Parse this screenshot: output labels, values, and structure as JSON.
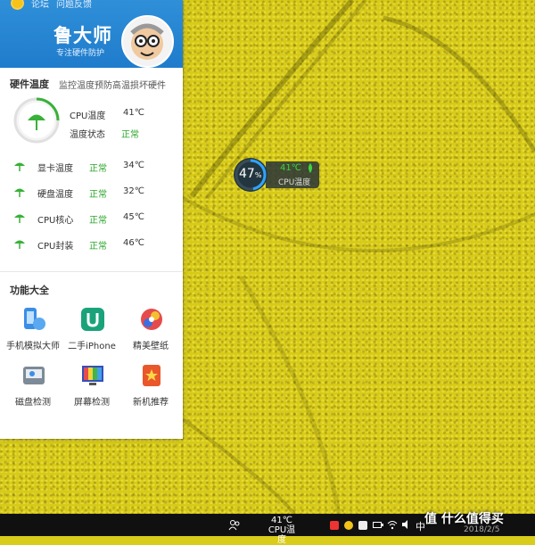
{
  "app": {
    "top_links": [
      "论坛",
      "问题反馈"
    ],
    "name": "鲁大师",
    "slogan": "专注硬件防护"
  },
  "hardware": {
    "title": "硬件温度",
    "subtitle": "监控温度预防高温损坏硬件",
    "cpu_temp_label": "CPU温度",
    "cpu_temp_value": "41℃",
    "status_label": "温度状态",
    "status_value": "正常",
    "rows": [
      {
        "label": "显卡温度",
        "status": "正常",
        "value": "34℃"
      },
      {
        "label": "硬盘温度",
        "status": "正常",
        "value": "32℃"
      },
      {
        "label": "CPU核心",
        "status": "正常",
        "value": "45℃"
      },
      {
        "label": "CPU封装",
        "status": "正常",
        "value": "46℃"
      }
    ]
  },
  "features": {
    "title": "功能大全",
    "items": [
      {
        "label": "手机模拟大师",
        "icon": "phone-emulator-icon"
      },
      {
        "label": "二手iPhone",
        "icon": "secondhand-iphone-icon"
      },
      {
        "label": "精美壁纸",
        "icon": "wallpaper-icon"
      },
      {
        "label": "磁盘检测",
        "icon": "disk-check-icon"
      },
      {
        "label": "屏幕检测",
        "icon": "screen-check-icon"
      },
      {
        "label": "新机推荐",
        "icon": "new-device-icon"
      }
    ]
  },
  "widget": {
    "load_percent": "47",
    "percent_sign": "%",
    "temp": "41℃",
    "label": "CPU温度"
  },
  "taskbar": {
    "temp": "41℃",
    "temp_label": "CPU温度",
    "ime": "中",
    "date": "2018/2/5"
  },
  "watermark": "值 什么值得买",
  "colors": {
    "header_blue": "#1f7ccc",
    "ok_green": "#2aa52a",
    "wallpaper_yellow": "#d8ca17",
    "taskbar": "#101010"
  }
}
